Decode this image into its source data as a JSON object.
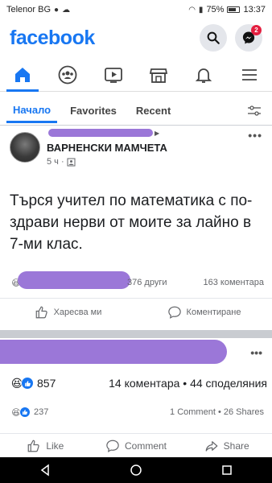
{
  "status_bar": {
    "carrier": "Telenor BG",
    "battery_percent": "75%",
    "time": "13:37"
  },
  "app_bar": {
    "logo": "facebook",
    "messenger_badge": "2"
  },
  "nav_icons": [
    "home-icon",
    "groups-icon",
    "watch-icon",
    "marketplace-icon",
    "notifications-icon",
    "menu-icon"
  ],
  "feed_tabs": [
    {
      "label": "Начало",
      "active": true
    },
    {
      "label": "Favorites",
      "active": false
    },
    {
      "label": "Recent",
      "active": false
    }
  ],
  "post1": {
    "group_name": "ВАРНЕНСКИ МАМЧЕТА",
    "time": "5 ч ·",
    "text": "Търся учител по математика с по-здрави нерви от моите за лайно в 7-ми клас.",
    "others": "376 други",
    "comments": "163 коментара",
    "like_label": "Харесва ми",
    "comment_label": "Коментиране"
  },
  "post2": {
    "reaction_count": "857",
    "summary": "14 коментара • 44 споделяния",
    "reaction_count_2": "237",
    "summary_2": "1 Comment • 26 Shares",
    "like_label": "Like",
    "comment_label": "Comment",
    "share_label": "Share"
  },
  "colors": {
    "brand": "#1877f2",
    "redaction": "#9b77d8"
  }
}
